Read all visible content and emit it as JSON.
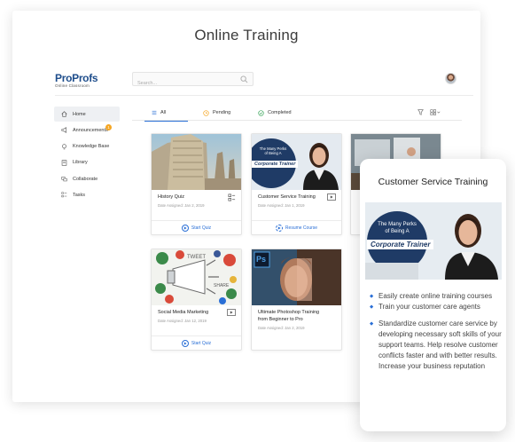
{
  "page": {
    "heading": "Online Training"
  },
  "brand": {
    "name_part1": "Pro",
    "name_part2": "Profs",
    "tagline": "Online Classroom",
    "color": "#1f4e8c",
    "accent": "#e05a2a"
  },
  "search": {
    "placeholder": "Search..."
  },
  "sidebar": {
    "items": [
      {
        "label": "Home",
        "icon": "home-icon",
        "active": true
      },
      {
        "label": "Announcements",
        "icon": "megaphone-icon",
        "badge": "1"
      },
      {
        "label": "Knowledge Base",
        "icon": "bulb-icon"
      },
      {
        "label": "Library",
        "icon": "library-icon"
      },
      {
        "label": "Collaborate",
        "icon": "collaborate-icon"
      },
      {
        "label": "Tasks",
        "icon": "tasks-icon"
      }
    ]
  },
  "tabs": [
    {
      "label": "All",
      "icon": "list-icon",
      "active": true
    },
    {
      "label": "Pending",
      "icon": "clock-icon"
    },
    {
      "label": "Completed",
      "icon": "check-circle-icon"
    }
  ],
  "toolbar": {
    "filter_icon": "filter-icon",
    "view_icon": "grid-view-icon"
  },
  "courses": [
    {
      "title": "History Quiz",
      "meta": "Date Assigned: Jan 2, 2019",
      "action": "Start Quiz",
      "type_icon": "quiz-icon"
    },
    {
      "title": "Customer Service Training",
      "meta": "Date Assigned: Jan 1, 2019",
      "action": "Resume Course",
      "type_icon": "video-icon"
    },
    {
      "title": "Social Media Marketing",
      "meta": "Date Assigned: Jan 12, 2019",
      "action": "Start Quiz",
      "type_icon": "video-icon"
    },
    {
      "title": "Ultimate Photoshop Training from Beginner to Pro",
      "meta": "Date Assigned: Jan 2, 2019",
      "action": "",
      "type_icon": ""
    }
  ],
  "thumbs": {
    "corporate_line1": "The Many Perks",
    "corporate_line2": "of Being A",
    "corporate_line3": "Corporate Trainer",
    "ps_label": "Ps"
  },
  "popup": {
    "title": "Customer Service Training",
    "bullets": [
      "Easily create online training courses",
      "Train your customer care agents",
      "Standardize customer care service by developing necessary soft skills of your support teams. Help resolve customer conflicts faster and with better results. Increase your business reputation"
    ]
  },
  "colors": {
    "accent": "#2a6fd6",
    "badge": "#f5a623"
  }
}
